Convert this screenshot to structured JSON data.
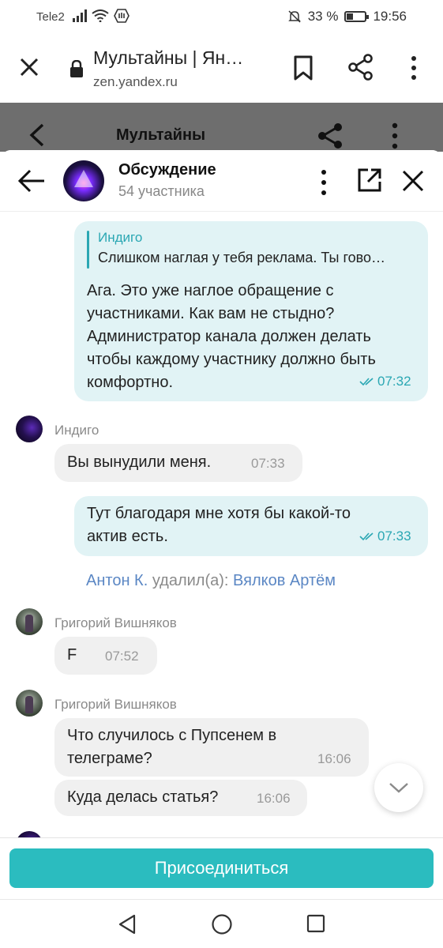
{
  "status_bar": {
    "carrier": "Tele2",
    "battery_percent_label": "33 %",
    "battery_level": 0.33,
    "time": "19:56"
  },
  "browser": {
    "page_title": "Мультайны | Ян…",
    "url": "zen.yandex.ru"
  },
  "page_header": {
    "title": "Мультайны"
  },
  "chat": {
    "title": "Обсуждение",
    "subtitle": "54 участника",
    "messages": [
      {
        "direction": "out",
        "quote_author": "Индиго",
        "quote_text": "Слишком наглая у тебя реклама. Ты гово…",
        "lines": [
          "Ага. Это уже наглое обращение с",
          "участниками. Как вам не стыдно?",
          "Администратор канала должен делать",
          "чтобы каждому участнику должно быть",
          "комфортно."
        ],
        "time": "07:32"
      },
      {
        "direction": "in",
        "sender": "Индиго",
        "text": "Вы вынудили меня.",
        "time": "07:33"
      },
      {
        "direction": "out",
        "lines": [
          "Тут благодаря мне хотя бы какой-то",
          "актив есть."
        ],
        "time": "07:33"
      },
      {
        "type": "system",
        "actor": "Антон К.",
        "action": " удалил(а): ",
        "target": "Вялков Артём"
      },
      {
        "direction": "in",
        "sender": "Григорий Вишняков",
        "text": "F",
        "time": "07:52"
      },
      {
        "direction": "in",
        "sender": "Григорий Вишняков",
        "lines": [
          "Что случилось с Пупсенем в",
          "телеграме?"
        ],
        "time": "16:06"
      },
      {
        "direction": "in",
        "text": "Куда делась статья?",
        "time": "16:06"
      }
    ],
    "join_label": "Присоединиться"
  },
  "colors": {
    "accent": "#2bbcbf",
    "outgoing_bubble": "#e1f3f5",
    "incoming_bubble": "#f0f0f0",
    "link": "#5b87c4",
    "page_header_bg": "#6e6e6e"
  }
}
